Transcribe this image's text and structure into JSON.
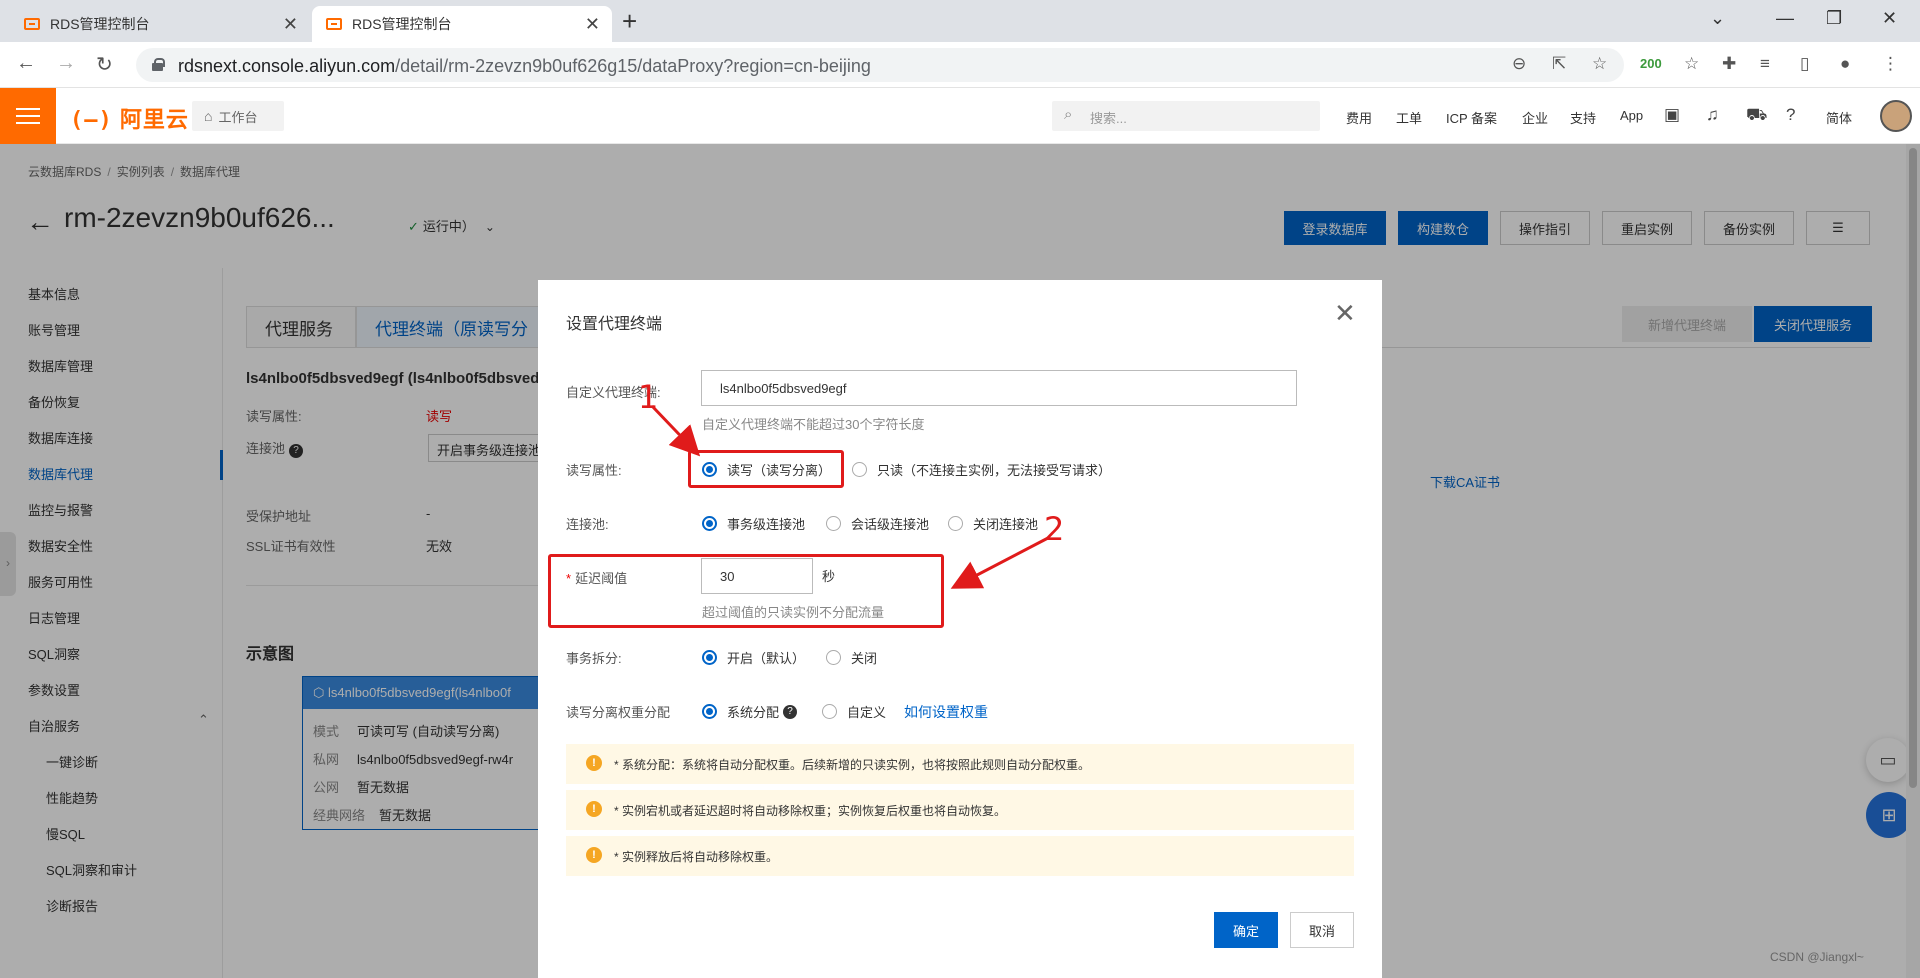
{
  "browser": {
    "tabs": [
      {
        "title": "RDS管理控制台",
        "active": false
      },
      {
        "title": "RDS管理控制台",
        "active": true
      }
    ],
    "url_host": "rdsnext.console.aliyun.com",
    "url_path": "/detail/rm-2zevzn9b0uf626g15/dataProxy?region=cn-beijing",
    "ext_badge": "200"
  },
  "topnav": {
    "logo": "阿里云",
    "workbench": "工作台",
    "search_placeholder": "搜索...",
    "links": [
      "费用",
      "工单",
      "ICP 备案",
      "企业",
      "支持",
      "App"
    ],
    "lang": "简体"
  },
  "breadcrumb": [
    "云数据库RDS",
    "实例列表",
    "数据库代理"
  ],
  "instance": {
    "id": "rm-2zevzn9b0uf626...",
    "status": "运行中）"
  },
  "header_buttons": [
    "登录数据库",
    "构建数仓",
    "操作指引",
    "重启实例",
    "备份实例"
  ],
  "sidebar": {
    "items": [
      "基本信息",
      "账号管理",
      "数据库管理",
      "备份恢复",
      "数据库连接",
      "数据库代理",
      "监控与报警",
      "数据安全性",
      "服务可用性",
      "日志管理",
      "SQL洞察",
      "参数设置",
      "自治服务"
    ],
    "sub_items": [
      "一键诊断",
      "性能趋势",
      "慢SQL",
      "SQL洞察和审计",
      "诊断报告"
    ],
    "active": "数据库代理"
  },
  "content": {
    "tabs": [
      "代理服务",
      "代理终端（原读写分"
    ],
    "right_buttons": [
      "新增代理终端",
      "关闭代理服务"
    ],
    "endpoint_name": "ls4nlbo0f5dbsved9egf (ls4nlbo0f5dbsved",
    "rw_label": "读写属性:",
    "rw_value": "读写",
    "pool_label": "连接池",
    "pool_value": "开启事务级连接池",
    "protected_label": "受保护地址",
    "protected_value": "-",
    "ssl_label": "SSL证书有效性",
    "ssl_value": "无效",
    "cert_link": "下载CA证书",
    "diagram_title": "示意图",
    "diagram": {
      "header": "ls4nlbo0f5dbsved9egf(ls4nlbo0f",
      "rows": [
        {
          "k": "模式",
          "v": "可读可写 (自动读写分离)"
        },
        {
          "k": "私网",
          "v": "ls4nlbo0f5dbsved9egf-rw4r"
        },
        {
          "k": "公网",
          "v": "暂无数据"
        },
        {
          "k": "经典网络",
          "v": "暂无数据"
        }
      ]
    }
  },
  "modal": {
    "title": "设置代理终端",
    "custom_label": "自定义代理终端:",
    "custom_value": "ls4nlbo0f5dbsved9egf",
    "custom_hint": "自定义代理终端不能超过30个字符长度",
    "rw_label": "读写属性:",
    "rw_options": [
      "读写（读写分离）",
      "只读（不连接主实例，无法接受写请求）"
    ],
    "pool_label": "连接池:",
    "pool_options": [
      "事务级连接池",
      "会话级连接池",
      "关闭连接池"
    ],
    "delay_label": "延迟阈值",
    "delay_value": "30",
    "delay_unit": "秒",
    "delay_hint": "超过阈值的只读实例不分配流量",
    "split_label": "事务拆分:",
    "split_options": [
      "开启（默认）",
      "关闭"
    ],
    "weight_label": "读写分离权重分配",
    "weight_options": [
      "系统分配",
      "自定义"
    ],
    "weight_link": "如何设置权重",
    "notices": [
      "* 系统分配：系统将自动分配权重。后续新增的只读实例，也将按照此规则自动分配权重。",
      "* 实例宕机或者延迟超时将自动移除权重；实例恢复后权重也将自动恢复。",
      "* 实例释放后将自动移除权重。"
    ],
    "ok": "确定",
    "cancel": "取消"
  },
  "annotations": [
    "1",
    "2"
  ],
  "watermark": "CSDN @Jiangxl~"
}
